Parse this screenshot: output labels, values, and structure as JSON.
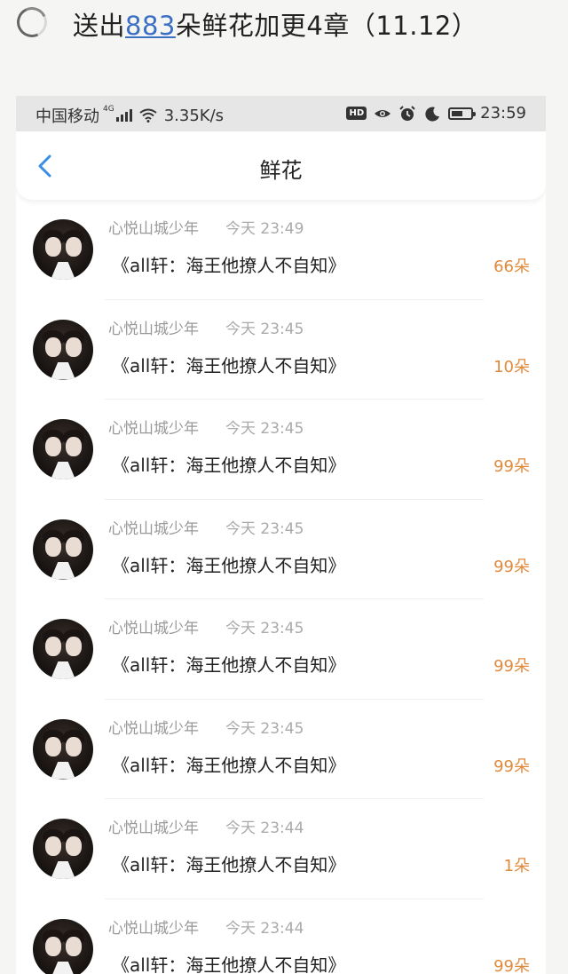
{
  "post": {
    "prefix": "送出",
    "link_number": "883",
    "suffix": "朵鲜花加更4章（11.12）"
  },
  "status_bar": {
    "carrier": "中国移动",
    "network": "4G",
    "speed": "3.35K/s",
    "hd_badge": "HD",
    "time": "23:59"
  },
  "nav": {
    "title": "鲜花"
  },
  "colors": {
    "accent_blue": "#3a8ee6",
    "count_orange": "#e08a3c",
    "link_blue": "#3a6fc4"
  },
  "rows": [
    {
      "user": "心悦山城少年",
      "time": "今天 23:49",
      "book": "《all轩：海王他撩人不自知》",
      "count": "66朵"
    },
    {
      "user": "心悦山城少年",
      "time": "今天 23:45",
      "book": "《all轩：海王他撩人不自知》",
      "count": "10朵"
    },
    {
      "user": "心悦山城少年",
      "time": "今天 23:45",
      "book": "《all轩：海王他撩人不自知》",
      "count": "99朵"
    },
    {
      "user": "心悦山城少年",
      "time": "今天 23:45",
      "book": "《all轩：海王他撩人不自知》",
      "count": "99朵"
    },
    {
      "user": "心悦山城少年",
      "time": "今天 23:45",
      "book": "《all轩：海王他撩人不自知》",
      "count": "99朵"
    },
    {
      "user": "心悦山城少年",
      "time": "今天 23:45",
      "book": "《all轩：海王他撩人不自知》",
      "count": "99朵"
    },
    {
      "user": "心悦山城少年",
      "time": "今天 23:44",
      "book": "《all轩：海王他撩人不自知》",
      "count": "1朵"
    },
    {
      "user": "心悦山城少年",
      "time": "今天 23:44",
      "book": "《all轩：海王他撩人不自知》",
      "count": "99朵"
    }
  ]
}
